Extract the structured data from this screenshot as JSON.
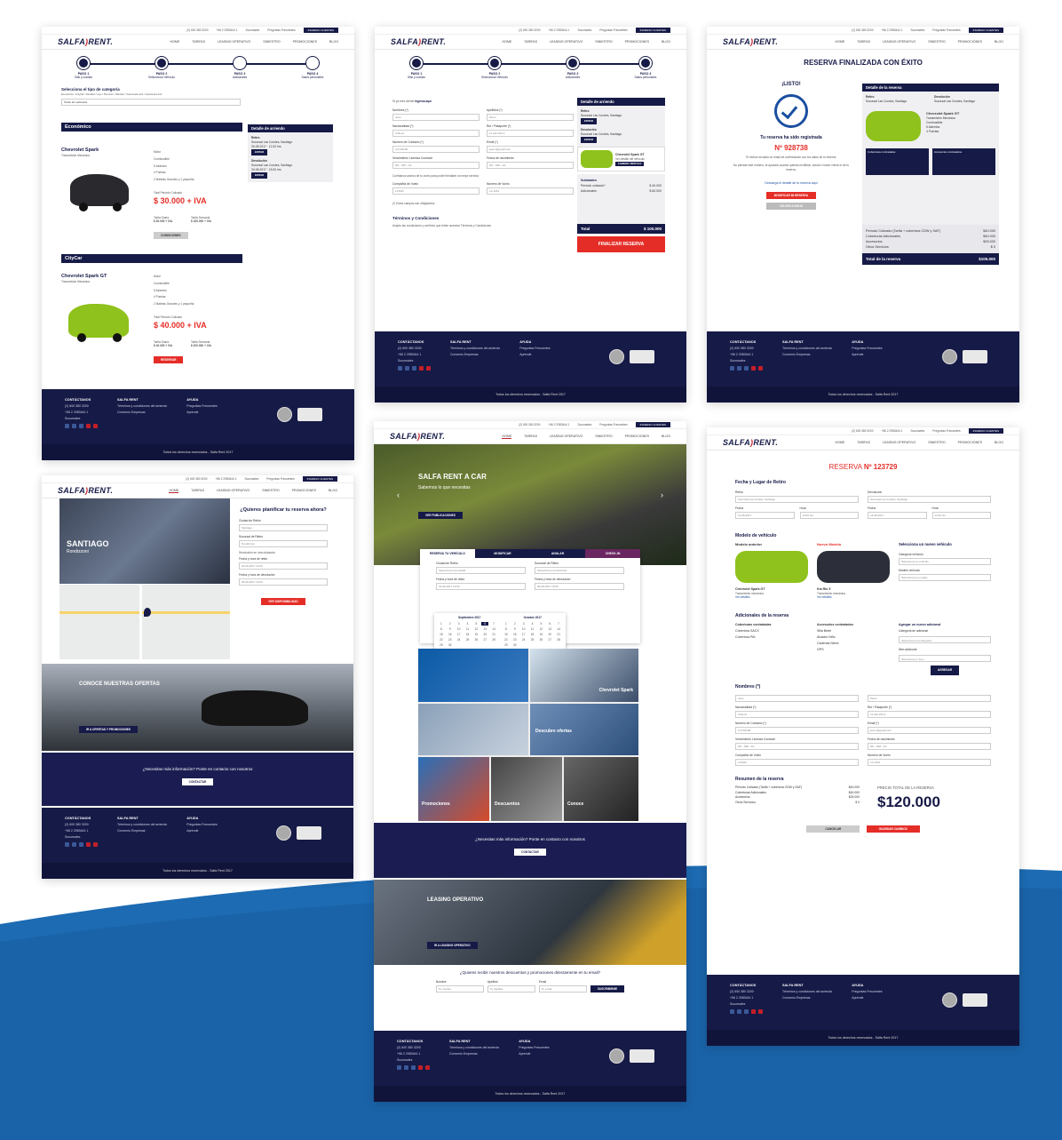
{
  "top": {
    "phone": "(2) 600 380 3200",
    "mobile": "+56 2 2983444 1",
    "branches": "Sucursales",
    "faq": "Preguntas Frecuentes",
    "clients": "INGRESO CLIENTES"
  },
  "brand": {
    "logo": "SALFA",
    "logo2": "RENT."
  },
  "nav": [
    "HOME",
    "TARIFAS",
    "LEASING OPERATIVO",
    "SINIESTRO",
    "PROMOCIONES",
    "BLOG"
  ],
  "footer": {
    "contact_title": "CONTÁCTANOS",
    "phone": "(2) 600 380 3200",
    "mobile": "+56 2 2983444 1",
    "branches": "Sucursales",
    "salfa_title": "SALFA RENT",
    "terms": "Términos y condiciones del arriendo",
    "companies": "Convenio Empresas",
    "help_title": "AYUDA",
    "faq": "Preguntas Frecuentes",
    "learn": "Aprende",
    "rights": "Todos los derechos reservados - Salfa Rent 2017"
  },
  "s1": {
    "steps": [
      {
        "title": "PASO 1",
        "sub": "Sitio y cuando"
      },
      {
        "title": "PASO 2",
        "sub": "Seleccionar Vehículo"
      },
      {
        "title": "PASO 3",
        "sub": "Adicionales"
      },
      {
        "title": "PASO 4",
        "sub": "Datos personales"
      }
    ],
    "choose": "Selecciona el tipo de categoría",
    "crumbs": "Económico / CityCar / Familiar / Lujo / Premium / Minivan / Camioneta 4x2 / Camioneta 4x4",
    "select": "Todos los vehículos",
    "cat1": "Económico",
    "car1": "Chevrolet Spark",
    "trans": "Transmisión Mecánica",
    "features": [
      "Motor",
      "Combustible",
      "5 Asientos",
      "4 Puertas",
      "2 Maletas Grandes y 1 pequeña"
    ],
    "total_label": "Total Periodo Cotizado",
    "price1": "$ 30.000 + IVA",
    "daily_label": "Tarifa Diaria",
    "weekly_label": "Tarifa Semanal",
    "daily1": "$ 30.000 + IVA",
    "weekly1": "$ 150.000 + IVA",
    "btn_conditions": "CONDICIONES",
    "cat2": "CityCar",
    "car2": "Chevrolet Spark GT",
    "price2": "$ 40.000 + IVA",
    "daily2": "$ 40.000 + IVA",
    "weekly2": "$ 200.000 + IVA",
    "btn_reserve": "RESERVAR",
    "side_title": "Detalle de arriendo",
    "pickup": "Retiro",
    "return": "Devolución",
    "branch": "Sucursal Las Condes, Santiago",
    "date": "30-08-2017",
    "time": "12.00 hrs",
    "time2": "15.00 hrs",
    "edit": "EDITAR"
  },
  "s2": {
    "login_hint": "Si ya eres cliente",
    "login_link": "ingresa aquí",
    "labels": [
      "Nombres (*)",
      "Apellidos (*)",
      "Nacionalidad (*)",
      "Rut / Pasaporte (*)",
      "Número de Contacto (*)",
      "Email (*)",
      "Vencimiento Licencia Conducir",
      "Fecha de nacimiento",
      "Compañía de Vuelo",
      "Número de Vuelo"
    ],
    "placeholders": [
      "Juan",
      "Pérez",
      "Chileno",
      "11.222.333-4",
      "+56",
      "9 2718190",
      "juan.t@gmail.com",
      "DD - MM - AA",
      "DD - MM - AA",
      "LATAM",
      "LA 1234"
    ],
    "promo": "Cuéntanos acerca de tu vuelo para poder brindarte un mejor servicio",
    "required": "(*) Estos campos son obligatorios",
    "terms_title": "Términos y Condiciones",
    "terms_check": "Acepto las condiciones y confirmo que leíste nuestros Términos y Condiciones",
    "side_title": "Detalle de arriendo",
    "car": "Chevrolet Spark GT",
    "car_sub": "Ver detalle del vehículo",
    "change": "CAMBIAR VEHÍCULO",
    "subtotals": "Subtotales",
    "period": "Período cotizado*",
    "period_v": "$ 40.000",
    "extras": "Adicionales",
    "extras_v": "$ 60.000",
    "total": "Total",
    "total_v": "$ 100.000",
    "finish": "FINALIZAR RESERVA"
  },
  "s3": {
    "title": "RESERVA FINALIZADA CON ÉXITO",
    "ready": "¡LISTO!",
    "registered": "Tu reserva ha sido registrada",
    "number": "Nº 928738",
    "msg1": "Te hemos enviado un email de confirmación con los datos de tu reserva.",
    "msg2": "No pierdas este número, te ayudará cuando quieras modificar, anular o hacer check-in de tu reserva.",
    "download": "Descarga el detalle de tu reserva aquí",
    "btn_modify": "MODIFICAR MI RESERVA",
    "btn_home": "VOLVER A INICIO",
    "side_title": "Detalle de la reserva",
    "pickup": "Retiro",
    "return": "Devolución",
    "branch": "Sucursal Las Condes, Santiago",
    "car": "Chevrolet Spark GT",
    "trans": "Transmisión Mecánica",
    "coverages": "Coberturas contratadas",
    "accessories": "Accesorios contratados",
    "rows": [
      {
        "k": "Período Cotizado (Tarifa + cobertura CDW y SAF)",
        "v": "$40.000"
      },
      {
        "k": "Coberturas Adicionales",
        "v": "$40.000"
      },
      {
        "k": "Accesorios",
        "v": "$25.000"
      },
      {
        "k": "Otros Servicios",
        "v": "$ 0"
      }
    ],
    "total": "Total de la reserva",
    "total_v": "$105.000"
  },
  "s4": {
    "city": "SANTIAGO",
    "branch_name": "Rondizzoni",
    "title": "¿Quieres planificar tu reserva ahora?",
    "city_label": "Ciudad de Retiro",
    "city_val": "Santiago",
    "branch_label": "Sucursal de Retiro",
    "branch_val": "Rondizzoni",
    "other": "Devolución en otra ubicación",
    "pick_label": "Fecha y hora de retiro",
    "pick_val": "02-09-2017    12:00",
    "ret_label": "Fecha y hora de devolución",
    "ret_val": "06-09-2017    15:00",
    "btn": "VER DISPONIBILIDAD",
    "offers": "CONOCE NUESTRAS OFERTAS",
    "offers_btn": "IR A OFERTAS Y PROMOCIONES",
    "more": "¿Necesitas más información? Ponte en contacto con nosotros",
    "contact": "CONTACTAR"
  },
  "s5": {
    "hero_title": "SALFA RENT A CAR",
    "hero_sub": "Sabemos lo que necesitas",
    "hero_btn": "VER PUBLICACIONES",
    "tabs": [
      "RESERVA TU VEHÍCULO",
      "MODIFICAR",
      "ANULAR",
      "CHECK-IN"
    ],
    "city_label": "Ciudad de Retiro",
    "city_val": "Selecciona una ciudad",
    "branch_label": "Sucursal de Retiro",
    "branch_val": "Selecciona una Sucursal",
    "pick_label": "Fecha y hora de retiro",
    "pick_val": "02-09-2017   12:00",
    "ret_label": "Fecha y hora de devolución",
    "ret_val": "06-09-2017   15:00",
    "months": [
      "Septiembre 2017",
      "Octubre 2017"
    ],
    "tiles": [
      "Promociones",
      "Descuentos",
      "Conoce",
      "Chevrolet Spark",
      "Descubre ofertas"
    ],
    "more": "¿Necesitas más información? Ponte en contacto con nosotros",
    "contact": "CONTACTAR",
    "leasing": "LEASING OPERATIVO",
    "leasing_btn": "IR A LEASING OPERATIVO",
    "news": "¿Quieres recibir nuestros descuentos y promociones directamente en tu email?",
    "news_labels": [
      "Nombre",
      "Apellido",
      "Email"
    ],
    "news_ph": [
      "Tu nombre",
      "Tu apellido",
      "Tu email"
    ],
    "subscribe": "SUSCRIBIRME"
  },
  "s6": {
    "title": "RESERVA",
    "number": "Nº 123729",
    "place": "Fecha y Lugar de Retiro",
    "pickup": "Retiro",
    "return": "Devolución",
    "branch": "Sucursal Las Condes, Santiago",
    "date_label": "Fecha",
    "hour_label": "Hora",
    "date": "12-08-2017",
    "hour": "12:00 hrs",
    "model": "Modelo de vehículo",
    "prev": "Modelo anterior",
    "new": "Nuevo Modelo",
    "pick_new": "Selecciona un nuevo vehículo",
    "car_prev": "Chevrolet Spark GT",
    "car_new": "Kia Rio 5",
    "trans": "Transmisión mecánica",
    "details": "Ver detalles",
    "cat_label": "Categoría vehículo",
    "cat_ph": "Selecciona un vehículo",
    "mod_label": "Modelo vehículo",
    "mod_ph": "Selecciona un modelo",
    "extras": "Adicionales de la reserva",
    "cov": "Coberturas contratadas",
    "acc": "Accesorios contratados",
    "add_new": "Agregar un nuevo adicional",
    "cov_items": [
      "Cobertura SACX",
      "Cobertura PAI"
    ],
    "acc_items": [
      "Silla Bebé",
      "Alzador Niño",
      "Cadenas Nieve",
      "GPS"
    ],
    "add_cat": "Categoría de adicional",
    "add_cat_ph": "Selecciona una categoría",
    "add_item": "Ítem adicional",
    "add_item_ph": "Selecciona un ítem",
    "add_btn": "AGREGAR",
    "personal": "Mis Datos Personales",
    "summary": "Resumen de la reserva",
    "rows": [
      {
        "k": "Período Cotizado (Tarifa + cobertura CDW y SAF)",
        "v": "$40.000"
      },
      {
        "k": "Coberturas Adicionales",
        "v": "$40.000"
      },
      {
        "k": "Accesorios",
        "v": "$25.000"
      },
      {
        "k": "Otros Servicios",
        "v": "$ 0"
      }
    ],
    "price_label": "PRECIO TOTAL DE LA RESERVA",
    "price": "$120.000",
    "cancel": "CANCELAR",
    "save": "GUARDAR CAMBIOS"
  }
}
